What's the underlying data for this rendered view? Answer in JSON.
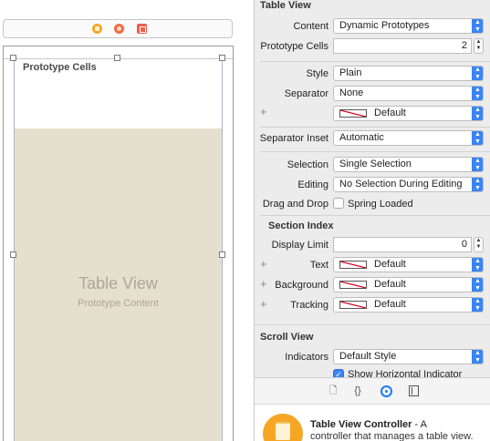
{
  "canvas": {
    "prototype_cells_header": "Prototype Cells",
    "table_view_title": "Table View",
    "table_view_subtitle": "Prototype Content"
  },
  "inspector": {
    "table_view": {
      "section_title": "Table View",
      "content_label": "Content",
      "content_value": "Dynamic Prototypes",
      "prototype_cells_label": "Prototype Cells",
      "prototype_cells_value": "2",
      "style_label": "Style",
      "style_value": "Plain",
      "separator_label": "Separator",
      "separator_value": "None",
      "separator_color_value": "Default",
      "separator_inset_label": "Separator Inset",
      "separator_inset_value": "Automatic",
      "selection_label": "Selection",
      "selection_value": "Single Selection",
      "editing_label": "Editing",
      "editing_value": "No Selection During Editing",
      "drag_drop_label": "Drag and Drop",
      "spring_loaded_label": "Spring Loaded",
      "spring_loaded_checked": false
    },
    "section_index": {
      "section_title": "Section Index",
      "display_limit_label": "Display Limit",
      "display_limit_value": "0",
      "text_label": "Text",
      "text_value": "Default",
      "background_label": "Background",
      "background_value": "Default",
      "tracking_label": "Tracking",
      "tracking_value": "Default"
    },
    "scroll_view": {
      "section_title": "Scroll View",
      "indicators_label": "Indicators",
      "indicators_value": "Default Style",
      "show_horizontal_label": "Show Horizontal Indicator",
      "show_horizontal_checked": true
    }
  },
  "library": {
    "tabs": [
      "file-template-icon",
      "code-snippet-icon",
      "object-library-icon",
      "media-library-icon"
    ],
    "selected_tab": "object-library-icon",
    "item_title": "Table View Controller",
    "item_title_suffix": " - A",
    "item_description": "controller that manages a table view."
  },
  "colors": {
    "accent": "#3a84f3",
    "table_placeholder": "#e5dfcd",
    "controller_icon": "#f5a623"
  }
}
